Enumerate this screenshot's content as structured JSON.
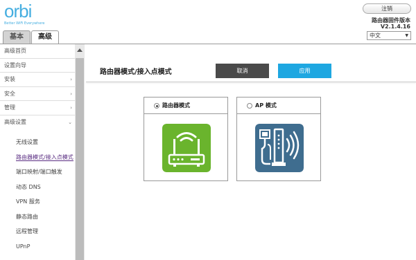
{
  "header": {
    "logo": "orbi",
    "tagline": "Better WiFi Everywhere",
    "tabs": [
      {
        "label": "基本"
      },
      {
        "label": "高级"
      }
    ],
    "logout_label": "注销",
    "firmware_label": "路由器固件版本",
    "firmware_version": "V2.1.4.16",
    "language": "中文"
  },
  "sidebar": {
    "items": [
      {
        "label": "高级首页"
      },
      {
        "label": "设置向导"
      },
      {
        "label": "安装"
      },
      {
        "label": "安全"
      },
      {
        "label": "管理"
      },
      {
        "label": "高级设置"
      }
    ],
    "subitems": [
      {
        "label": "无线设置"
      },
      {
        "label": "路由器模式/接入点模式"
      },
      {
        "label": "端口映射/端口触发"
      },
      {
        "label": "动态 DNS"
      },
      {
        "label": "VPN 服务"
      },
      {
        "label": "静态路由"
      },
      {
        "label": "远程管理"
      },
      {
        "label": "UPnP"
      }
    ]
  },
  "main": {
    "title": "路由器模式/接入点模式",
    "cancel_label": "取消",
    "apply_label": "应用",
    "router_mode_label": "路由器模式",
    "ap_mode_label": "AP 模式",
    "selected_mode": "router"
  },
  "colors": {
    "accent": "#1ea7e1",
    "router_icon_bg": "#6ab42d",
    "ap_icon_bg": "#3f6d8f",
    "active_nav": "#5a2d82"
  }
}
